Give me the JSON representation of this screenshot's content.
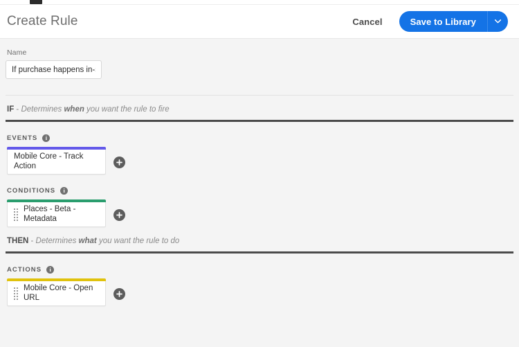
{
  "colors": {
    "accent_blue": "#1473e6",
    "events_bar": "#6359e9",
    "conditions_bar": "#2a9d6e",
    "actions_bar": "#e0c20d",
    "rule_dark": "#4b4b4b",
    "page_bg": "#f4f4f4"
  },
  "header": {
    "title": "Create Rule",
    "cancel_label": "Cancel",
    "save_label": "Save to Library",
    "save_caret_icon": "chevron-down-icon"
  },
  "name_field": {
    "label": "Name",
    "value": "If purchase happens in-store",
    "placeholder": "Rule name"
  },
  "if_clause": {
    "keyword": "IF",
    "dash": " - ",
    "text_before": "Determines ",
    "emphasis": "when",
    "text_after": " you want the rule to fire"
  },
  "then_clause": {
    "keyword": "THEN",
    "dash": " - ",
    "text_before": "Determines ",
    "emphasis": "what",
    "text_after": " you want the rule to do"
  },
  "sections": {
    "events": {
      "title": "EVENTS",
      "info_icon": "info-icon",
      "add_icon": "plus-circle-icon",
      "cards": [
        {
          "label": "Mobile Core - Track Action",
          "accent": "#6359e9",
          "has_drag_handle": false
        }
      ]
    },
    "conditions": {
      "title": "CONDITIONS",
      "info_icon": "info-icon",
      "add_icon": "plus-circle-icon",
      "cards": [
        {
          "label": "Places - Beta - Metadata",
          "accent": "#2a9d6e",
          "has_drag_handle": true
        }
      ]
    },
    "actions": {
      "title": "ACTIONS",
      "info_icon": "info-icon",
      "add_icon": "plus-circle-icon",
      "cards": [
        {
          "label": "Mobile Core - Open URL",
          "accent": "#e0c20d",
          "has_drag_handle": true
        }
      ]
    }
  }
}
